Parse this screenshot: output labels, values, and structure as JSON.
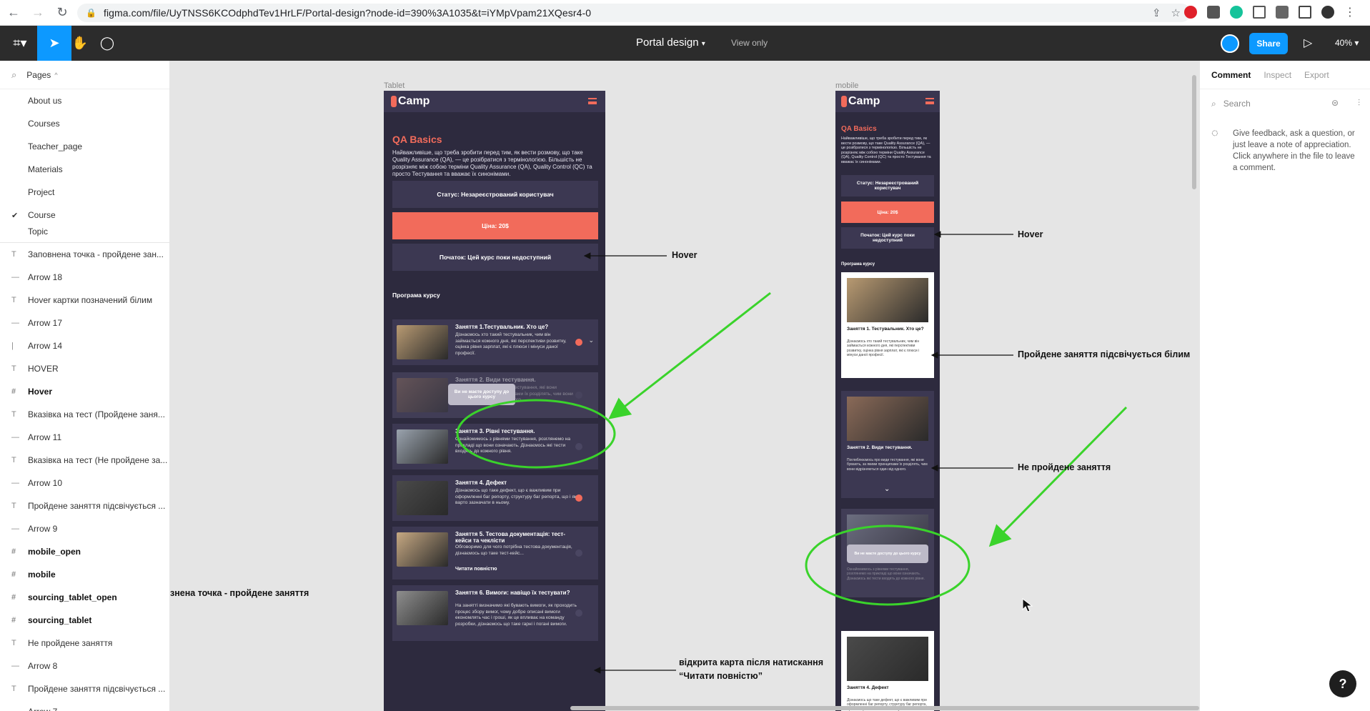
{
  "browser": {
    "url": "figma.com/file/UyTNSS6KCOdphdTev1HrLF/Portal-design?node-id=390%3A1035&t=iYMpVpam21XQesr4-0"
  },
  "figma": {
    "doc_title": "Portal design",
    "view_only": "View only",
    "share_label": "Share",
    "zoom": "40%"
  },
  "left_panel": {
    "pages_label": "Pages",
    "pages": [
      "About us",
      "Courses",
      "Teacher_page",
      "Materials",
      "Project",
      "Course",
      "Topic"
    ],
    "selected_page": "Course",
    "layers": [
      {
        "icon": "T",
        "label": "Заповнена точка - пройдене зан...",
        "bold": false
      },
      {
        "icon": "—",
        "label": "Arrow 18",
        "bold": false
      },
      {
        "icon": "T",
        "label": "Hover картки позначений білим",
        "bold": false
      },
      {
        "icon": "—",
        "label": "Arrow 17",
        "bold": false
      },
      {
        "icon": "|",
        "label": "Arrow 14",
        "bold": false
      },
      {
        "icon": "T",
        "label": "HOVER",
        "bold": false
      },
      {
        "icon": "#",
        "label": "Hover",
        "bold": true
      },
      {
        "icon": "T",
        "label": "Вказівка на тест (Пройдене заня...",
        "bold": false
      },
      {
        "icon": "—",
        "label": "Arrow 11",
        "bold": false
      },
      {
        "icon": "T",
        "label": "Вказівка на тест (Не пройдене за...",
        "bold": false
      },
      {
        "icon": "—",
        "label": "Arrow 10",
        "bold": false
      },
      {
        "icon": "T",
        "label": "Пройдене заняття підсвічується ...",
        "bold": false
      },
      {
        "icon": "—",
        "label": "Arrow 9",
        "bold": false
      },
      {
        "icon": "#",
        "label": "mobile_open",
        "bold": true
      },
      {
        "icon": "#",
        "label": "mobile",
        "bold": true
      },
      {
        "icon": "#",
        "label": "sourcing_tablet_open",
        "bold": true
      },
      {
        "icon": "#",
        "label": "sourcing_tablet",
        "bold": true
      },
      {
        "icon": "T",
        "label": "Не пройдене заняття",
        "bold": false
      },
      {
        "icon": "—",
        "label": "Arrow 8",
        "bold": false
      },
      {
        "icon": "T",
        "label": "Пройдене заняття підсвічується ...",
        "bold": false
      },
      {
        "icon": "—",
        "label": "Arrow 7",
        "bold": false
      }
    ]
  },
  "right_panel": {
    "tabs": [
      "Comment",
      "Inspect",
      "Export"
    ],
    "search_placeholder": "Search",
    "feedback": "Give feedback, ask a question, or just leave a note of appreciation. Click anywhere in the file to leave a comment."
  },
  "canvas": {
    "tablet_label": "Tablet",
    "mobile_label": "mobile",
    "logo_text": "Camp",
    "course_title": "QA Basics",
    "course_desc": "Найважливіше, що треба зробити перед тим, як вести розмову, що таке Quality Assurance (QA), — це розібратися з термінологією. Більшість не розрізняє між собою терміни Quality Assurance (QA), Quality Control (QC) та просто Тестування та вважає їх синонімами.",
    "status": "Статус: Незареєстрований користувач",
    "price": "Ціна: 20$",
    "start": "Початок: Цей курс поки недоступний",
    "program_label": "Програма курсу",
    "locked_text": "Ви не маєте доступу до цього курсу",
    "tablet_lessons": [
      {
        "title": "Заняття 1.Тестувальник. Хто це?",
        "desc": "Дізнаємось хто такий тестувальник, чим він займається кожного дня, які перспективи розвитку, оцінка рівня зарплат, які є плюси і мінуси даної професії.",
        "done": true
      },
      {
        "title": "Заняття 2. Види тестування.",
        "desc": "Поглиблюємось про види тестування, які вони бувають, за якими принципами їх розділять, чим вони відрізняються один від одного.",
        "done": false
      },
      {
        "title": "Заняття 3. Рівні тестування.",
        "desc": "Ознайомимось з рівнями тестування, розглянемо на прикладі що вони означають. Дізнаємось які тести входять до кожного рівня.",
        "done": false
      },
      {
        "title": "Заняття 4. Дефект",
        "desc": "Дізнаємось що таке дефект, що є важливим при оформленні баг репорту, структуру баг репорта, що і як варто зазначати в ньому.",
        "done": true
      },
      {
        "title": "Заняття 5. Тестова документація: тест-кейси та чекліcти",
        "desc": "Обговоримо для чого потрібна тестова документація, дізнаємось що таке тест-кейс...",
        "read_more": "Читати повністю",
        "done": false
      },
      {
        "title": "Заняття 6. Вимоги: навіщо їх тестувати?",
        "desc": "На занятті визначимо які бувають вимоги, як проходить процес збору вимог, чому добре описані вимоги економлять час і гроші, як це впливає на команду розробки, дізнаємось що таке гарні і погані вимоги.",
        "done": false
      }
    ],
    "mobile_lessons": [
      {
        "title": "Заняття 1. Тестувальник. Хто це?",
        "desc": "Дізнаємось хто такий тестувальник, чим він займається кожного дня, які перспективи розвитку, оцінка рівня зарплат, які є плюси і мінуси даної професії."
      },
      {
        "title": "Заняття 2. Види тестування.",
        "desc": "Поглиблюємось про види тестування, які вони бувають, за якими принципами їх розділять, чим вони відрізняються один від одного."
      },
      {
        "title": "",
        "desc": "Ознайомимось з рівнями тестування, розглянемо на прикладі що вони означають. Дізнаємось які тести входять до кожного рівня."
      },
      {
        "title": "Заняття 4. Дефект",
        "desc": "Дізнаємось що таке дефект, що є важливим при оформленні баг репорту, структуру баг репорта, що і як варто зазначати в ньому."
      }
    ],
    "annotations": {
      "hover_tablet": "Hover",
      "hover_mobile": "Hover",
      "passed_lesson": "Пройдене заняття підсвічується білим",
      "not_passed": "Не пройдене заняття",
      "filled_dot": "знена точка - пройдене заняття",
      "open_card": "відкрита карта після натискання “Читати повністю”"
    },
    "colors": {
      "frame_bg": "#2d2a3e",
      "accent": "#f26b5b",
      "highlight_green": "#3ad32b",
      "figma_blue": "#0d99ff"
    }
  }
}
